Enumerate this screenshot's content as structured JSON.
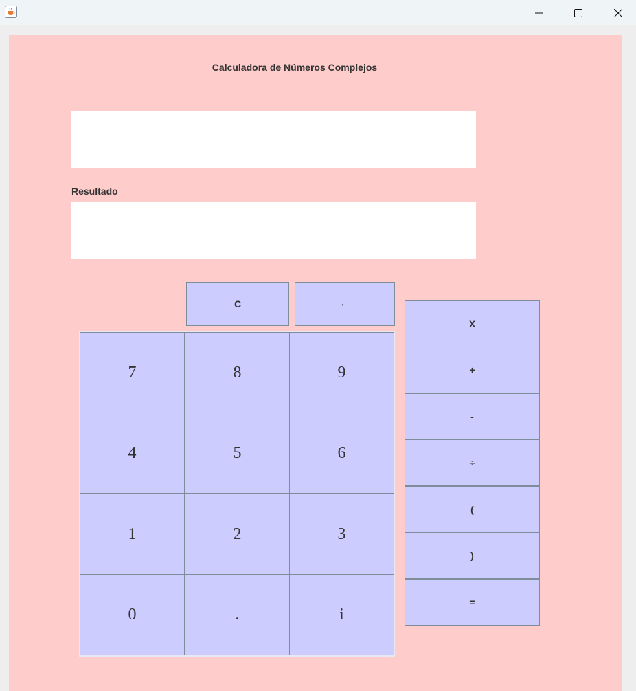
{
  "window": {
    "app_icon": "java-cup-icon",
    "controls": [
      "minimize-icon",
      "maximize-icon",
      "close-icon"
    ]
  },
  "app": {
    "title": "Calculadora de Números Complejos",
    "expression_value": "",
    "result_label": "Resultado",
    "result_value": ""
  },
  "top_buttons": {
    "clear": "C",
    "backspace": "←"
  },
  "keypad": {
    "rows": [
      [
        "7",
        "8",
        "9"
      ],
      [
        "4",
        "5",
        "6"
      ],
      [
        "1",
        "2",
        "3"
      ],
      [
        "0",
        ".",
        "i"
      ]
    ]
  },
  "operators": [
    "X",
    "+",
    "-",
    "÷",
    "(",
    ")",
    "="
  ],
  "colors": {
    "panel_bg": "#ffcccc",
    "button_bg": "#ccccff",
    "button_border": "#7f8c99",
    "text": "#333333"
  }
}
